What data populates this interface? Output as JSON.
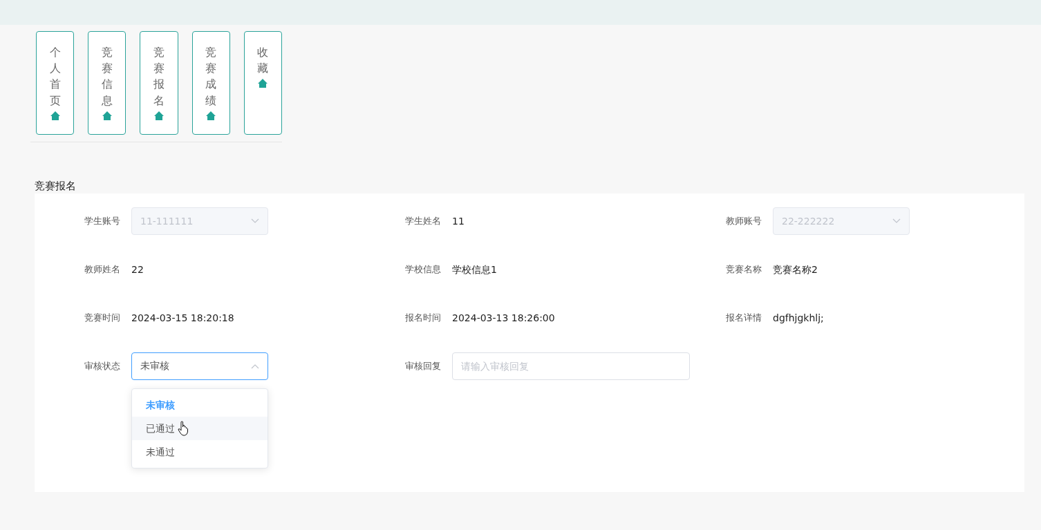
{
  "nav": [
    {
      "label": "个人首页"
    },
    {
      "label": "竞赛信息"
    },
    {
      "label": "竞赛报名"
    },
    {
      "label": "竞赛成绩"
    },
    {
      "label": "收藏"
    }
  ],
  "section_title": "竞赛报名",
  "fields": [
    {
      "label": "学生账号",
      "kind": "select",
      "value": "11-111111",
      "disabled": true,
      "open": false
    },
    {
      "label": "学生姓名",
      "kind": "text",
      "value": "11"
    },
    {
      "label": "教师账号",
      "kind": "select",
      "value": "22-222222",
      "disabled": true,
      "open": false
    },
    {
      "label": "教师姓名",
      "kind": "text",
      "value": "22"
    },
    {
      "label": "学校信息",
      "kind": "text",
      "value": "学校信息1"
    },
    {
      "label": "竞赛名称",
      "kind": "text",
      "value": "竞赛名称2"
    },
    {
      "label": "竞赛时间",
      "kind": "text",
      "value": "2024-03-15 18:20:18"
    },
    {
      "label": "报名时间",
      "kind": "text",
      "value": "2024-03-13 18:26:00"
    },
    {
      "label": "报名详情",
      "kind": "text",
      "value": "dgfhjgkhlj;"
    },
    {
      "label": "审核状态",
      "kind": "select",
      "value": "未审核",
      "disabled": false,
      "open": true,
      "options": [
        {
          "label": "未审核",
          "selected": true,
          "hovered": false
        },
        {
          "label": "已通过",
          "selected": false,
          "hovered": true
        },
        {
          "label": "未通过",
          "selected": false,
          "hovered": false
        }
      ]
    },
    {
      "label": "审核回复",
      "kind": "input",
      "placeholder": "请输入审核回复"
    }
  ]
}
